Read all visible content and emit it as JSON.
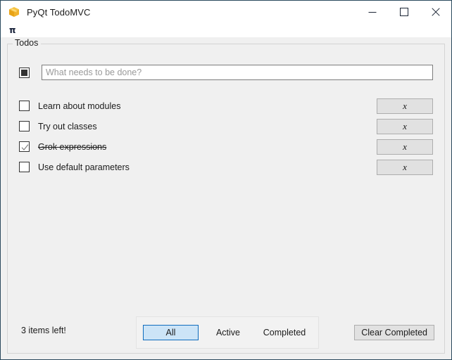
{
  "window": {
    "title": "PyQt TodoMVC",
    "icon": "package-box-icon",
    "controls": {
      "minimize": "minimize-icon",
      "maximize": "maximize-icon",
      "close": "close-icon"
    },
    "border_color": "#2b4a5e"
  },
  "menubar": {
    "items": [
      {
        "label": "π"
      }
    ]
  },
  "groupbox": {
    "title": "Todos"
  },
  "new_todo": {
    "toggle_all_state": "partial",
    "placeholder": "What needs to be done?",
    "value": ""
  },
  "todos": [
    {
      "label": "Learn about modules",
      "checked": false,
      "delete_label": "х"
    },
    {
      "label": "Try out classes",
      "checked": false,
      "delete_label": "х"
    },
    {
      "label": "Grok expressions",
      "checked": true,
      "delete_label": "х"
    },
    {
      "label": "Use default parameters",
      "checked": false,
      "delete_label": "х"
    }
  ],
  "footer": {
    "items_left": "3 items left!",
    "filters": [
      {
        "label": "All",
        "selected": true
      },
      {
        "label": "Active",
        "selected": false
      },
      {
        "label": "Completed",
        "selected": false
      }
    ],
    "clear_completed": "Clear Completed"
  },
  "colors": {
    "accent": "#0f6cbd",
    "accent_fill": "#cce4f7",
    "content_bg": "#f0f0f0",
    "button_bg": "#e1e1e1"
  }
}
